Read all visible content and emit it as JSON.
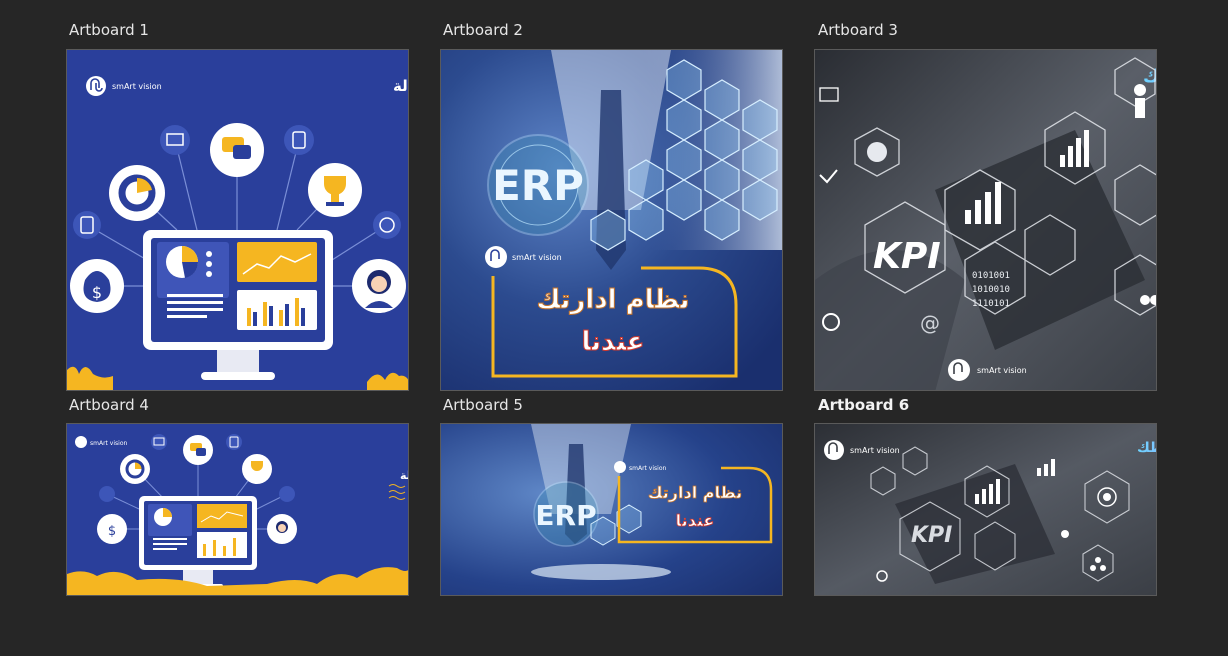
{
  "artboards": [
    {
      "label": "Artboard 1",
      "title_ar": "هتوصل لعميلك برسالة",
      "logo_text": "smArt vision"
    },
    {
      "label": "Artboard 2",
      "erp": "ERP",
      "logo_text": "smArt vision",
      "line1_ar": "نظام ادارتك",
      "line2_ar": "عندنا"
    },
    {
      "label": "Artboard 3",
      "title_ar": "تطبيقات خاصه بنشاطك",
      "kpi": "KPI",
      "logo_text": "smArt vision",
      "binary": [
        "0101001",
        "1010010",
        "1110101"
      ]
    },
    {
      "label": "Artboard 4",
      "title_ar": "هتوصل لعميلك برسالة",
      "logo_text": "smArt vision"
    },
    {
      "label": "Artboard 5",
      "erp": "ERP",
      "logo_text": "smArt vision",
      "line1_ar": "نظام ادارتك",
      "line2_ar": "عندنا"
    },
    {
      "label": "Artboard 6",
      "title_ar": "تطبيقات خاصه بنشاطك",
      "kpi": "KPI",
      "logo_text": "smArt vision"
    }
  ],
  "selected_artboard": "Artboard 6",
  "colors": {
    "canvas": "#262626",
    "blue": "#2a3f9b",
    "yellow": "#f5b621",
    "dark_gray": "#3b3f46"
  }
}
